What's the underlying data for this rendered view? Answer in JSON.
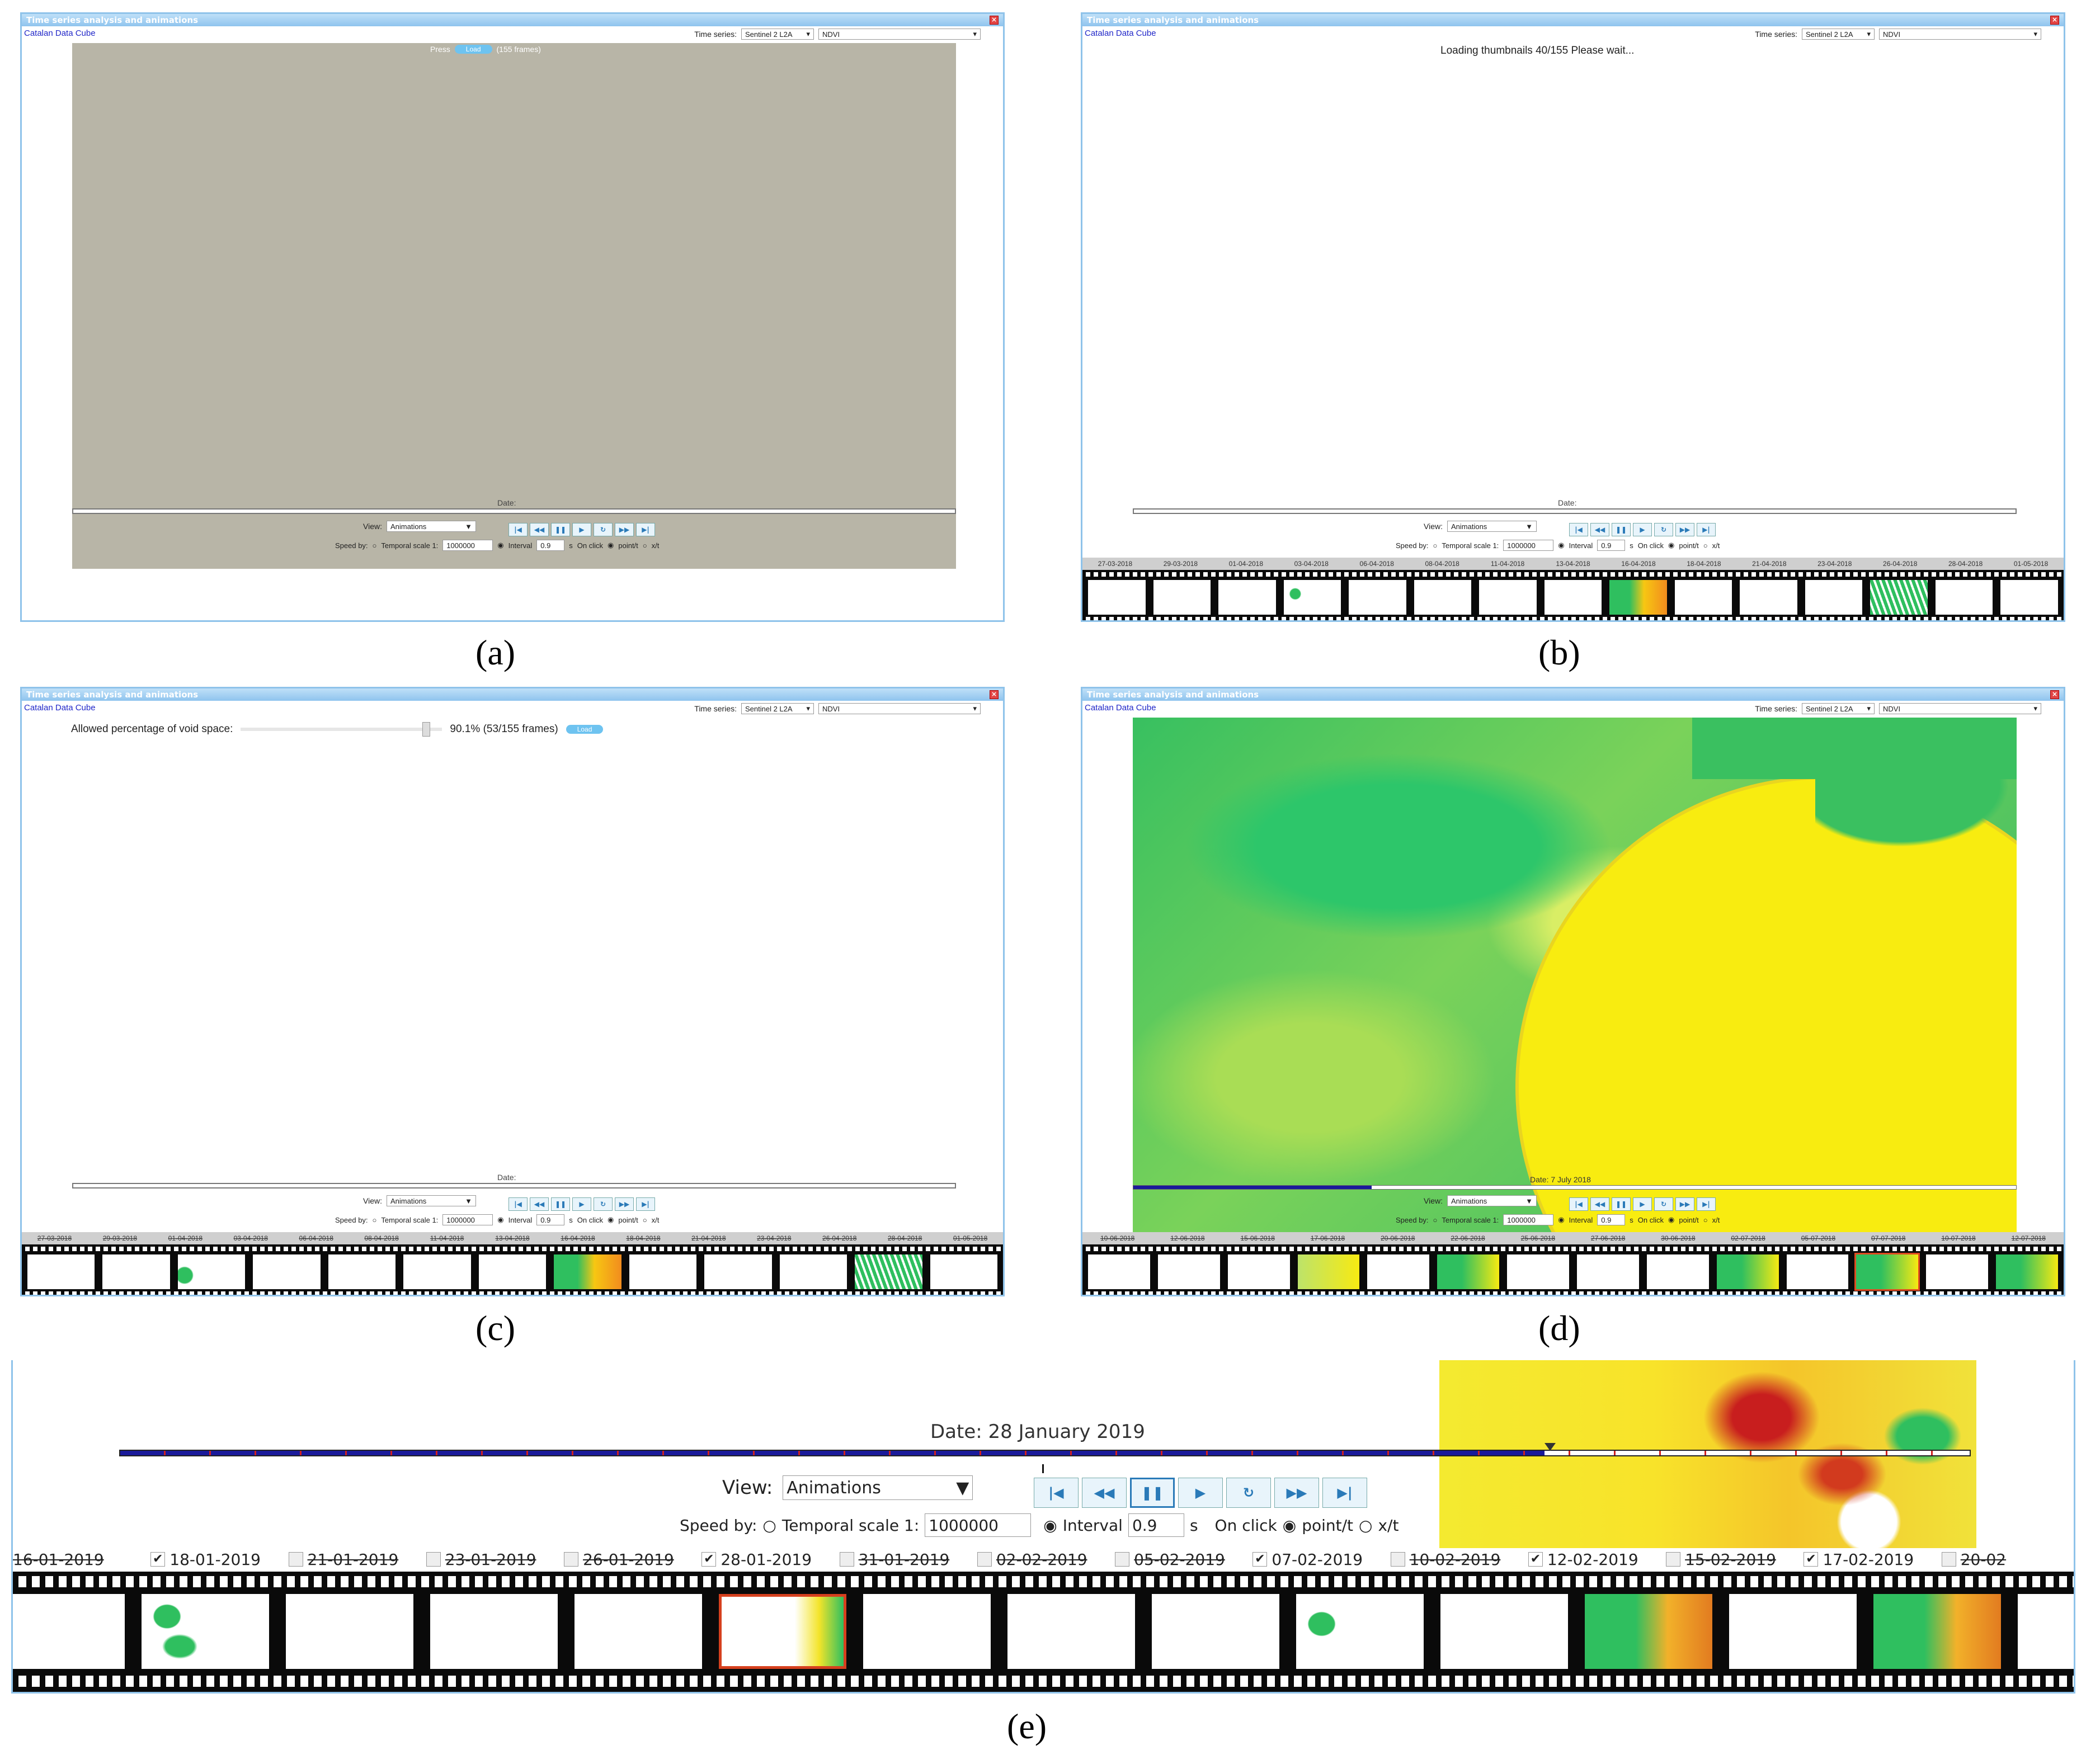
{
  "window": {
    "title": "Time series analysis and animations",
    "close": "×",
    "brand": "Catalan Data Cube",
    "ts_label": "Time series:",
    "ts_sensor": "Sentinel 2 L2A",
    "ts_index": "NDVI"
  },
  "controls": {
    "view_label": "View:",
    "view_value": "Animations",
    "speed_label": "Speed by:",
    "temporal_scale": "Temporal scale 1:",
    "scale_value": "1000000",
    "interval_label": "Interval",
    "interval_value": "0.9",
    "seconds": "s",
    "onclick": "On click",
    "point_t": "point/t",
    "x_t": "x/t",
    "date_label": "Date:"
  },
  "panel_a": {
    "press": "Press",
    "load": "Load",
    "frames": "(155 frames)",
    "caption": "(a)"
  },
  "panel_b": {
    "loading": "Loading thumbnails 40/155 Please wait...",
    "caption": "(b)",
    "dates": [
      "27-03-2018",
      "29-03-2018",
      "01-04-2018",
      "03-04-2018",
      "06-04-2018",
      "08-04-2018",
      "11-04-2018",
      "13-04-2018",
      "16-04-2018",
      "18-04-2018",
      "21-04-2018",
      "23-04-2018",
      "26-04-2018",
      "28-04-2018",
      "01-05-2018"
    ]
  },
  "panel_c": {
    "void_label": "Allowed percentage of void space:",
    "void_value": "90.1% (53/155 frames)",
    "load": "Load",
    "caption": "(c)",
    "dates": [
      "27-03-2018",
      "29-03-2018",
      "01-04-2018",
      "03-04-2018",
      "06-04-2018",
      "08-04-2018",
      "11-04-2018",
      "13-04-2018",
      "16-04-2018",
      "18-04-2018",
      "21-04-2018",
      "23-04-2018",
      "26-04-2018",
      "28-04-2018",
      "01-05-2018"
    ]
  },
  "panel_d": {
    "date": "Date: 7 July 2018",
    "caption": "(d)",
    "dates": [
      "10-06-2018",
      "12-06-2018",
      "15-06-2018",
      "17-06-2018",
      "20-06-2018",
      "22-06-2018",
      "25-06-2018",
      "27-06-2018",
      "30-06-2018",
      "02-07-2018",
      "05-07-2018",
      "07-07-2018",
      "10-07-2018",
      "12-07-2018"
    ]
  },
  "panel_e": {
    "date": "Date: 28 January 2019",
    "caption": "(e)",
    "dates": [
      {
        "d": "16-01-2019",
        "on": false
      },
      {
        "d": "18-01-2019",
        "on": true
      },
      {
        "d": "21-01-2019",
        "on": false
      },
      {
        "d": "23-01-2019",
        "on": false
      },
      {
        "d": "26-01-2019",
        "on": false
      },
      {
        "d": "28-01-2019",
        "on": true
      },
      {
        "d": "31-01-2019",
        "on": false
      },
      {
        "d": "02-02-2019",
        "on": false
      },
      {
        "d": "05-02-2019",
        "on": false
      },
      {
        "d": "07-02-2019",
        "on": true
      },
      {
        "d": "10-02-2019",
        "on": false
      },
      {
        "d": "12-02-2019",
        "on": true
      },
      {
        "d": "15-02-2019",
        "on": false
      },
      {
        "d": "17-02-2019",
        "on": true
      },
      {
        "d": "20-02",
        "on": false
      }
    ]
  },
  "colors": {
    "title_bar": "#8fc4ee",
    "timeline_blue": "#1a1a9a",
    "tick_red": "#d02020",
    "ndvi_green": "#2fbf5f",
    "ndvi_yellow": "#f7ea12",
    "ndvi_orange": "#f28c1e",
    "ndvi_red": "#c81e1e"
  }
}
